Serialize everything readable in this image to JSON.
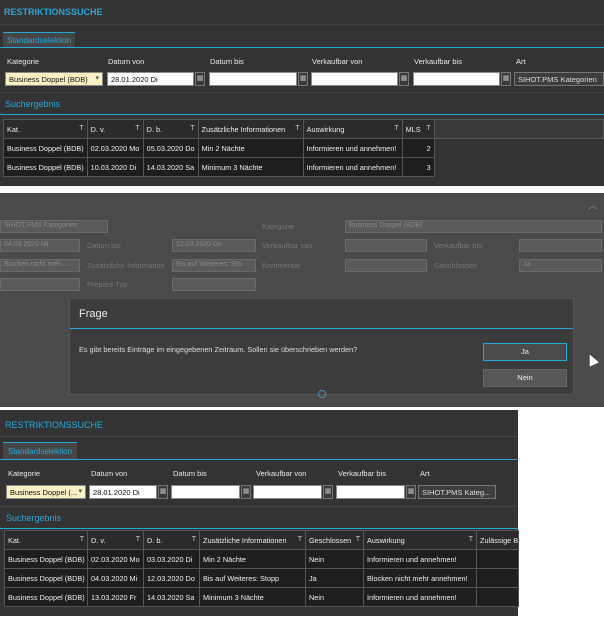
{
  "top": {
    "title": "RESTRIKTIONSSUCHE",
    "tab": "Standardselektion",
    "filters": {
      "kategorie_label": "Kategorie",
      "kategorie_value": "Business Doppel (BDB)",
      "datum_von_label": "Datum von",
      "datum_von_value": "28.01.2020 Di",
      "datum_bis_label": "Datum bis",
      "verkaufbar_von_label": "Verkaufbar von",
      "verkaufbar_bis_label": "Verkaufbar bis",
      "art_label": "Art",
      "art_value": "SIHOT.PMS Kategorien"
    },
    "results_title": "Suchergebnis",
    "columns": [
      "Kat.",
      "D. v.",
      "D. b.",
      "Zusätzliche Informationen",
      "Auswirkung",
      "MLS"
    ],
    "rows": [
      [
        "Business Doppel (BDB)",
        "02.03.2020 Mo",
        "05.03.2020 Do",
        "Min 2 Nächte",
        "Informieren und annehmen!",
        "2"
      ],
      [
        "Business Doppel (BDB)",
        "10.03.2020 Di",
        "14.03.2020 Sa",
        "Minimum 3 Nächte",
        "Informieren und annehmen!",
        "3"
      ]
    ]
  },
  "middle": {
    "collapse_icon": "chevron-up-icon",
    "background_form": {
      "art_value": "SIHOT.PMS Kategorien",
      "kategorie_label": "Kategorie",
      "kategorie_value": "Business Doppel (BDB)",
      "date_from_value": "04.03.2020 Mi",
      "datum_bis_label": "Datum bis",
      "datum_bis_value": "12.03.2020 Do",
      "verkaufbar_von_label": "Verkaufbar von",
      "verkaufbar_bis_label": "Verkaufbar bis",
      "auswirkung_value": "Blocken nicht meh...",
      "zusatz_label": "Zusätzliche Information",
      "zusatz_value": "Bis auf Weiteres: Sto",
      "kommentar_label": "Kommentar",
      "geschlossen_label": "Geschlossen",
      "geschlossen_value": "Ja",
      "prepaid_label": "Prepaid-Typ"
    },
    "dialog": {
      "title": "Frage",
      "message": "Es gibt bereits Einträge im eingegebenen Zeitraum. Sollen sie überschrieben werden?",
      "yes_label": "Ja",
      "no_label": "Nein"
    }
  },
  "bottom": {
    "title": "RESTRIKTIONSSUCHE",
    "tab": "Standardselektion",
    "filters": {
      "kategorie_label": "Kategorie",
      "kategorie_value": "Business Doppel (...",
      "datum_von_label": "Datum von",
      "datum_von_value": "28.01.2020 Di",
      "datum_bis_label": "Datum bis",
      "verkaufbar_von_label": "Verkaufbar von",
      "verkaufbar_bis_label": "Verkaufbar bis",
      "art_label": "Art",
      "art_value": "SIHOT.PMS Kateg..."
    },
    "results_title": "Suchergebnis",
    "columns": [
      "Kat.",
      "D. v.",
      "D. b.",
      "Zusätzliche Informationen",
      "Geschlossen",
      "Auswirkung",
      "Zulässige B"
    ],
    "rows": [
      [
        "Business Doppel (BDB)",
        "02.03.2020 Mo",
        "03.03.2020 Di",
        "Min 2 Nächte",
        "Nein",
        "Informieren und annehmen!",
        ""
      ],
      [
        "Business Doppel (BDB)",
        "04.03.2020 Mi",
        "12.03.2020 Do",
        "Bis auf Weiteres: Stopp",
        "Ja",
        "Blocken nicht mehr annehmen!",
        ""
      ],
      [
        "Business Doppel (BDB)",
        "13.03.2020 Fr",
        "14.03.2020 Sa",
        "Minimum 3 Nächte",
        "Nein",
        "Informieren und annehmen!",
        ""
      ]
    ]
  }
}
